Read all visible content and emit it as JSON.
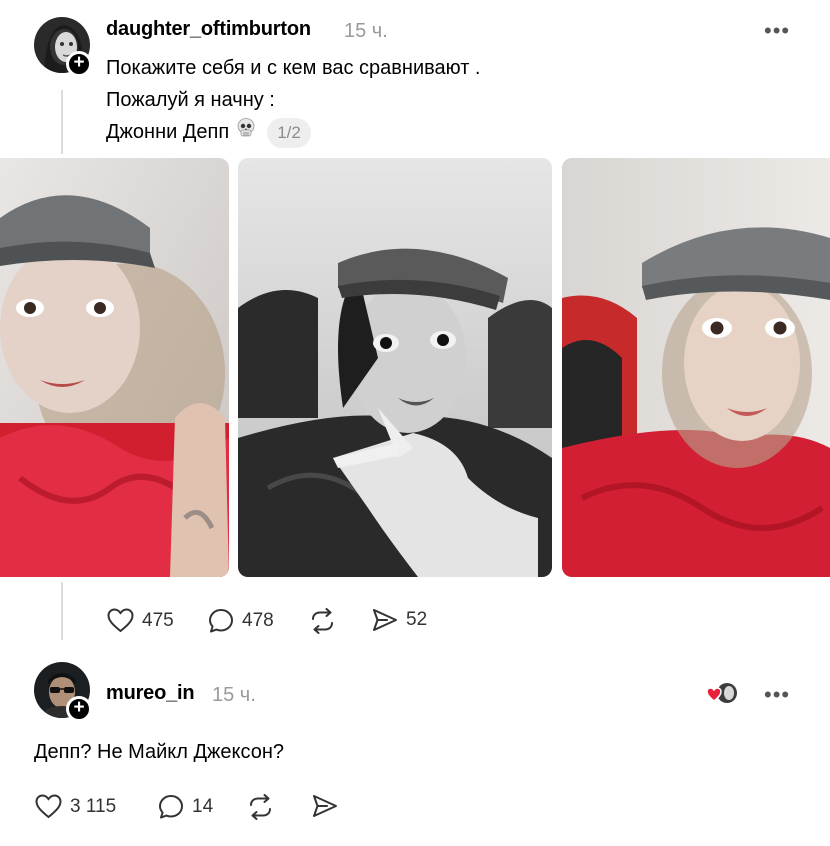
{
  "post": {
    "username": "daughter_oftimburton",
    "time": "15 ч.",
    "more_icon": "•••",
    "lines": [
      "Покажите себя и с кем вас сравнивают .",
      "Пожалуй я начну :",
      "Джонни Депп"
    ],
    "media_counter": "1/2",
    "actions": {
      "likes": "475",
      "comments": "478",
      "shares": "52"
    }
  },
  "reply": {
    "username": "mureo_in",
    "time": "15 ч.",
    "more_icon": "•••",
    "text": "Депп? Не Майкл Джексон?",
    "actions": {
      "likes": "3 115",
      "comments": "14"
    }
  },
  "colors": {
    "accent_red": "#e8203a",
    "muted_text": "#9a9a9a",
    "thread_line": "#dcdcdc"
  }
}
